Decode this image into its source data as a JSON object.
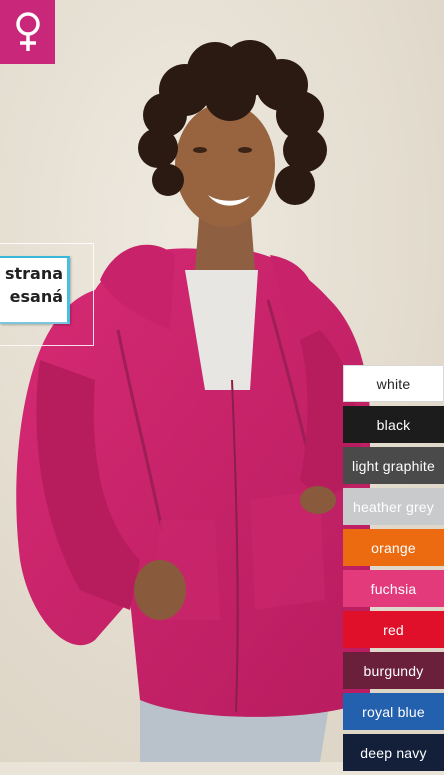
{
  "product": {
    "feature_line1": "strana",
    "feature_line2": "esaná",
    "gender_icon": "female-icon",
    "brand_color": "#c8277a"
  },
  "colors": [
    {
      "name": "white",
      "bg": "#ffffff",
      "fg": "#222222"
    },
    {
      "name": "black",
      "bg": "#1c1c1c",
      "fg": "#ffffff"
    },
    {
      "name": "light graphite",
      "bg": "#4a4a4a",
      "fg": "#ffffff"
    },
    {
      "name": "heather grey",
      "bg": "#c8cacc",
      "fg": "#ffffff"
    },
    {
      "name": "orange",
      "bg": "#ec6b11",
      "fg": "#ffffff"
    },
    {
      "name": "fuchsia",
      "bg": "#e33a7c",
      "fg": "#ffffff"
    },
    {
      "name": "red",
      "bg": "#e0102a",
      "fg": "#ffffff"
    },
    {
      "name": "burgundy",
      "bg": "#6a1f3a",
      "fg": "#ffffff"
    },
    {
      "name": "royal blue",
      "bg": "#2360ad",
      "fg": "#ffffff"
    },
    {
      "name": "deep navy",
      "bg": "#14203a",
      "fg": "#ffffff"
    }
  ]
}
